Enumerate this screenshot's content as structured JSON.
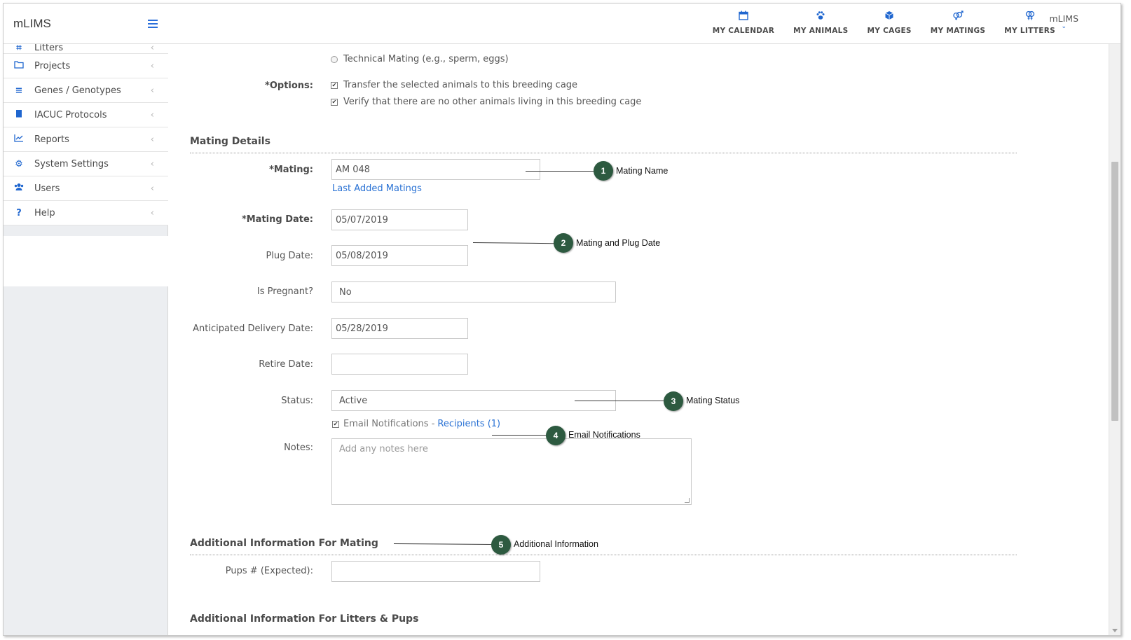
{
  "app": {
    "brand": "mLIMS"
  },
  "sidebar": {
    "items": [
      {
        "label": "Litters",
        "icon": "litter-icon"
      },
      {
        "label": "Projects",
        "icon": "folder-icon"
      },
      {
        "label": "Genes / Genotypes",
        "icon": "list-icon"
      },
      {
        "label": "IACUC Protocols",
        "icon": "book-icon"
      },
      {
        "label": "Reports",
        "icon": "chart-icon"
      },
      {
        "label": "System Settings",
        "icon": "gear-icon"
      },
      {
        "label": "Users",
        "icon": "users-icon"
      },
      {
        "label": "Help",
        "icon": "question-icon"
      }
    ]
  },
  "topnav": {
    "links": [
      {
        "label": "MY CALENDAR",
        "icon": "calendar-icon"
      },
      {
        "label": "MY ANIMALS",
        "icon": "paw-icon"
      },
      {
        "label": "MY CAGES",
        "icon": "cube-icon"
      },
      {
        "label": "MY MATINGS",
        "icon": "mating-icon"
      },
      {
        "label": "MY LITTERS",
        "icon": "litters-icon"
      }
    ],
    "user": "mLIMS"
  },
  "form": {
    "technical_mating": "Technical Mating  (e.g., sperm, eggs)",
    "options_label": "*Options:",
    "option_transfer": "Transfer the selected animals to this breeding cage",
    "option_verify": "Verify that there are no other animals living in this breeding cage",
    "mating_details_title": "Mating Details",
    "mating_label": "*Mating:",
    "mating_value": "AM 048",
    "last_added_link": "Last Added Matings",
    "mating_date_label": "*Mating Date:",
    "mating_date_value": "05/07/2019",
    "plug_date_label": "Plug Date:",
    "plug_date_value": "05/08/2019",
    "pregnant_label": "Is Pregnant?",
    "pregnant_value": "No",
    "delivery_label": "Anticipated Delivery Date:",
    "delivery_value": "05/28/2019",
    "retire_label": "Retire Date:",
    "retire_value": "",
    "status_label": "Status:",
    "status_value": "Active",
    "email_label": "Email Notifications - ",
    "recipients_link": "Recipients (1)",
    "notes_label": "Notes:",
    "notes_placeholder": "Add any notes here",
    "additional_title": "Additional Information For Mating",
    "pups_label": "Pups # (Expected):",
    "pups_value": "",
    "next_section_title": "Additional Information For Litters & Pups"
  },
  "callouts": [
    {
      "num": "1",
      "text": "Mating Name"
    },
    {
      "num": "2",
      "text": "Mating and Plug Date"
    },
    {
      "num": "3",
      "text": "Mating Status"
    },
    {
      "num": "4",
      "text": "Email Notifications"
    },
    {
      "num": "5",
      "text": "Additional Information"
    }
  ],
  "colors": {
    "accent": "#1f66cf",
    "badge": "#2d5a40",
    "link": "#2a72d4"
  }
}
